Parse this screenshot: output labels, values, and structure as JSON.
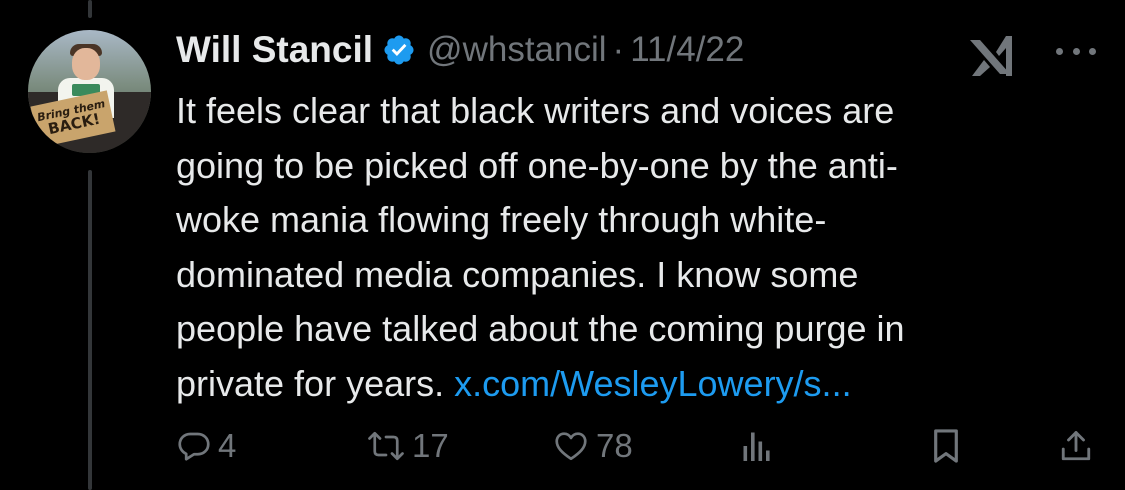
{
  "tweet": {
    "author": {
      "display_name": "Will Stancil",
      "handle": "@whstancil",
      "verified_icon": "verified-badge-icon",
      "avatar_sign_line1": "Bring them",
      "avatar_sign_line2": "BACK!"
    },
    "separator": "·",
    "date": "11/4/22",
    "text_lines": [
      "It feels clear that black writers and voices are",
      "going to be picked off one-by-one by the anti-",
      "woke mania flowing freely through white-",
      "dominated media companies. I know some",
      "people have talked about the coming purge in",
      "private for years."
    ],
    "link_text": "x.com/WesleyLowery/s..."
  },
  "stats": {
    "replies": "4",
    "retweets": "17",
    "likes": "78"
  },
  "icons": {
    "grok": "grok-icon",
    "more": "more-icon",
    "reply": "reply-icon",
    "retweet": "retweet-icon",
    "like": "heart-icon",
    "views": "views-icon",
    "bookmark": "bookmark-icon",
    "share": "share-icon"
  },
  "colors": {
    "background": "#000000",
    "text": "#e7e9ea",
    "secondary": "#71767b",
    "link": "#1d9bf0",
    "verified": "#1d9bf0"
  }
}
